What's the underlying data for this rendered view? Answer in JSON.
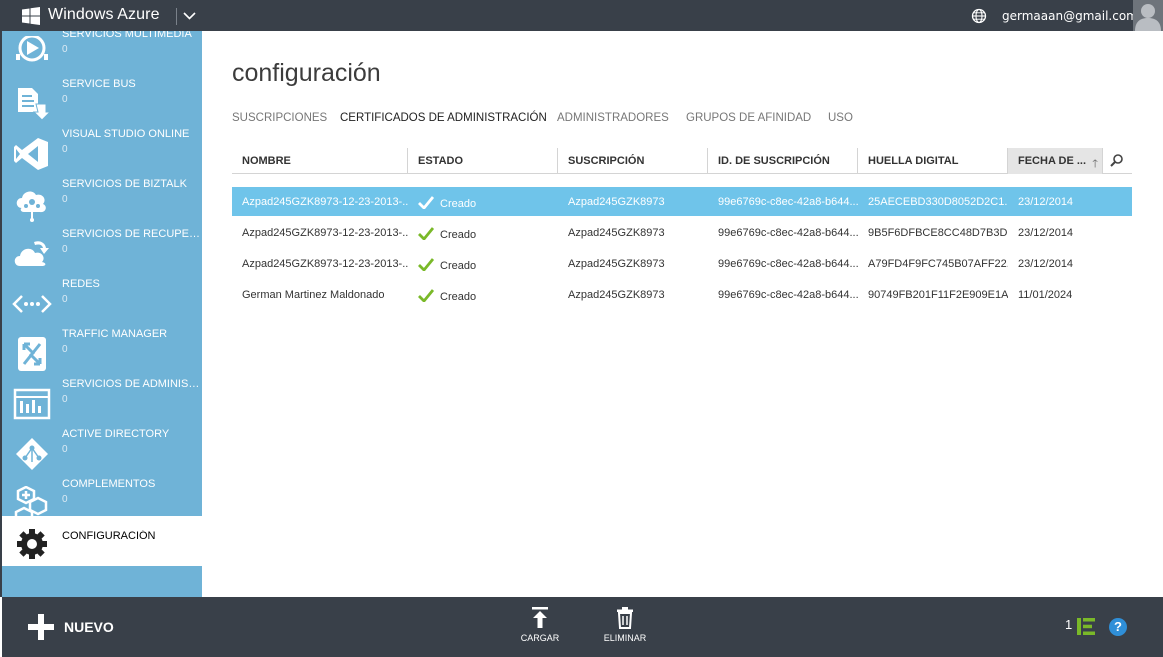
{
  "topbar": {
    "brand": "Windows Azure",
    "user_email": "germaaan@gmail.com"
  },
  "sidebar": {
    "items": [
      {
        "label": "SERVICIOS MULTIMEDIA",
        "count": "0",
        "icon": "media-services-icon"
      },
      {
        "label": "SERVICE BUS",
        "count": "0",
        "icon": "service-bus-icon"
      },
      {
        "label": "VISUAL STUDIO ONLINE",
        "count": "0",
        "icon": "visual-studio-icon"
      },
      {
        "label": "SERVICIOS DE BIZTALK",
        "count": "0",
        "icon": "biztalk-icon"
      },
      {
        "label": "SERVICIOS DE RECUPERA...",
        "count": "0",
        "icon": "recovery-cloud-icon"
      },
      {
        "label": "REDES",
        "count": "0",
        "icon": "networks-icon"
      },
      {
        "label": "TRAFFIC MANAGER",
        "count": "0",
        "icon": "traffic-manager-icon"
      },
      {
        "label": "SERVICIOS DE ADMINISTR...",
        "count": "0",
        "icon": "management-services-icon"
      },
      {
        "label": "ACTIVE DIRECTORY",
        "count": "0",
        "icon": "active-directory-icon"
      },
      {
        "label": "COMPLEMENTOS",
        "count": "0",
        "icon": "addons-icon"
      },
      {
        "label": "CONFIGURACIÓN",
        "count": "",
        "icon": "gear-icon"
      }
    ]
  },
  "main": {
    "title": "configuración",
    "tabs": [
      {
        "label": "SUSCRIPCIONES"
      },
      {
        "label": "CERTIFICADOS DE ADMINISTRACIÓN"
      },
      {
        "label": "ADMINISTRADORES"
      },
      {
        "label": "GRUPOS DE AFINIDAD"
      },
      {
        "label": "USO"
      }
    ],
    "columns": [
      "NOMBRE",
      "ESTADO",
      "SUSCRIPCIÓN",
      "ID. DE SUSCRIPCIÓN",
      "HUELLA DIGITAL",
      "FECHA DE ..."
    ],
    "rows": [
      {
        "name": "Azpad245GZK8973-12-23-2013-...",
        "status": "Creado",
        "subscription": "Azpad245GZK8973",
        "subscription_id": "99e6769c-c8ec-42a8-b644...",
        "thumbprint": "25AECEBD330D8052D2C1...",
        "date": "23/12/2014"
      },
      {
        "name": "Azpad245GZK8973-12-23-2013-...",
        "status": "Creado",
        "subscription": "Azpad245GZK8973",
        "subscription_id": "99e6769c-c8ec-42a8-b644...",
        "thumbprint": "9B5F6DFBCE8CC48D7B3D...",
        "date": "23/12/2014"
      },
      {
        "name": "Azpad245GZK8973-12-23-2013-...",
        "status": "Creado",
        "subscription": "Azpad245GZK8973",
        "subscription_id": "99e6769c-c8ec-42a8-b644...",
        "thumbprint": "A79FD4F9FC745B07AFF22...",
        "date": "23/12/2014"
      },
      {
        "name": "German Martinez Maldonado",
        "status": "Creado",
        "subscription": "Azpad245GZK8973",
        "subscription_id": "99e6769c-c8ec-42a8-b644...",
        "thumbprint": "90749FB201F11F2E909E1A...",
        "date": "11/01/2024"
      }
    ]
  },
  "commandbar": {
    "new_label": "NUEVO",
    "upload_label": "CARGAR",
    "delete_label": "ELIMINAR",
    "counter": "1"
  },
  "colors": {
    "topbar": "#394049",
    "sidebar": "#6fb3d7",
    "selected_row": "#6fc4ea",
    "check": "#7ab929",
    "help": "#2f8fd8"
  }
}
